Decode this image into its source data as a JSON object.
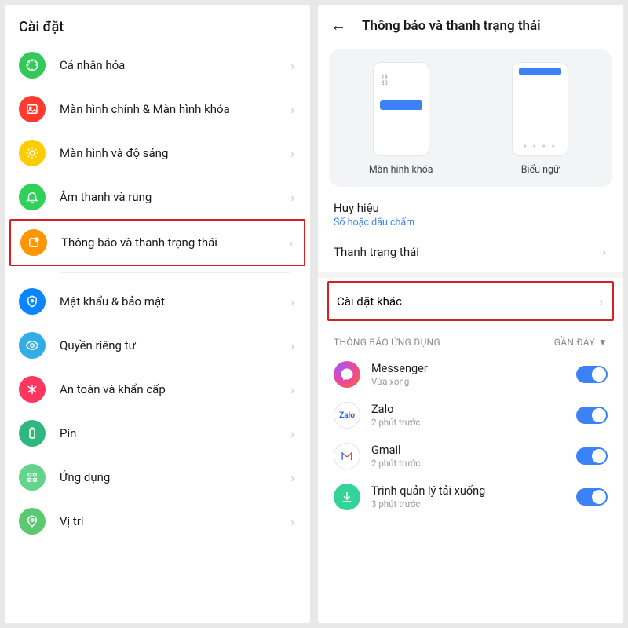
{
  "left": {
    "title": "Cài đặt",
    "rows": [
      {
        "label": "Cá nhân hóa"
      },
      {
        "label": "Màn hình chính & Màn hình khóa"
      },
      {
        "label": "Màn hình và độ sáng"
      },
      {
        "label": "Âm thanh và rung"
      },
      {
        "label": "Thông báo và thanh trạng thái"
      },
      {
        "label": "Mật khẩu & bảo mật"
      },
      {
        "label": "Quyền riêng tư"
      },
      {
        "label": "An toàn và khẩn cấp"
      },
      {
        "label": "Pin"
      },
      {
        "label": "Ứng dụng"
      },
      {
        "label": "Vị trí"
      }
    ]
  },
  "right": {
    "title": "Thông báo và thanh trạng thái",
    "preview": {
      "lock_label": "Màn hình khóa",
      "banner_label": "Biểu ngữ",
      "lock_time": "19\n30"
    },
    "badge_section": {
      "title": "Huy hiệu",
      "link": "Số hoặc dấu chấm"
    },
    "status_bar_row": "Thanh trạng thái",
    "other_settings_row": "Cài đặt khác",
    "apps_header": "THÔNG BÁO ỨNG DỤNG",
    "sort_label": "GẦN ĐÂY",
    "apps": [
      {
        "name": "Messenger",
        "sub": "Vừa xong"
      },
      {
        "name": "Zalo",
        "sub": "2 phút trước"
      },
      {
        "name": "Gmail",
        "sub": "2 phút trước"
      },
      {
        "name": "Trình quản lý tải xuống",
        "sub": "3 phút trước"
      }
    ]
  }
}
